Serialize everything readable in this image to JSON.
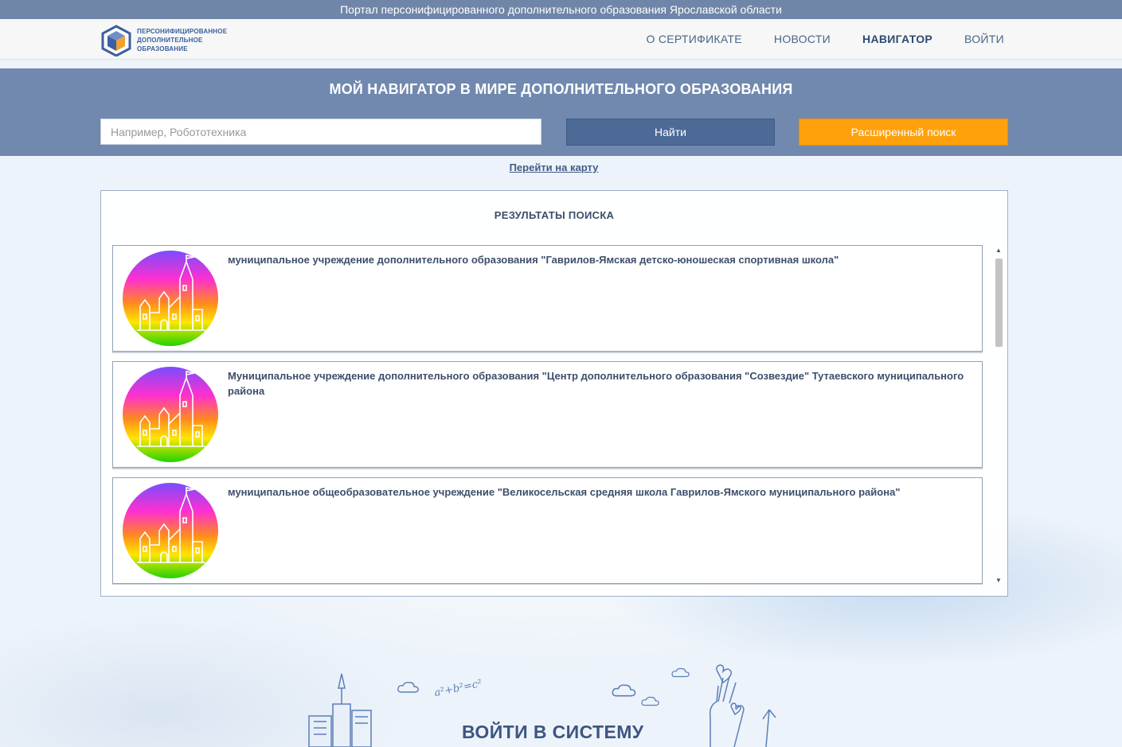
{
  "topbar": {
    "text": "Портал персонифицированного дополнительного образования Ярославской области"
  },
  "logo": {
    "line1": "ПЕРСОНИФИЦИРОВАННОЕ",
    "line2": "ДОПОЛНИТЕЛЬНОЕ",
    "line3": "ОБРАЗОВАНИЕ"
  },
  "nav": {
    "items": [
      {
        "label": "О СЕРТИФИКАТЕ"
      },
      {
        "label": "НОВОСТИ"
      },
      {
        "label": "НАВИГАТОР"
      },
      {
        "label": "ВОЙТИ"
      }
    ]
  },
  "hero": {
    "title": "МОЙ НАВИГАТОР В МИРЕ ДОПОЛНИТЕЛЬНОГО ОБРАЗОВАНИЯ",
    "search_placeholder": "Например, Робототехника",
    "find_label": "Найти",
    "advanced_label": "Расширенный поиск"
  },
  "map_link": "Перейти на карту",
  "results": {
    "title": "РЕЗУЛЬТАТЫ ПОИСКА",
    "items": [
      {
        "title": "муниципальное учреждение дополнительного образования \"Гаврилов-Ямская детско-юношеская спортивная школа\""
      },
      {
        "title": "Муниципальное учреждение дополнительного образования \"Центр дополнительного образования \"Созвездие\" Тутаевского муниципального района"
      },
      {
        "title": "муниципальное общеобразовательное учреждение \"Великосельская средняя школа Гаврилов-Ямского муниципального района\""
      }
    ]
  },
  "footer": {
    "login_title": "ВОЙТИ В СИСТЕМУ",
    "formula": "a²+b²=c²"
  },
  "colors": {
    "topbar": "#6f86a8",
    "hero": "#7189af",
    "find": "#4d6a96",
    "advanced": "#ffa10a",
    "text_dark": "#3d4f6a"
  }
}
